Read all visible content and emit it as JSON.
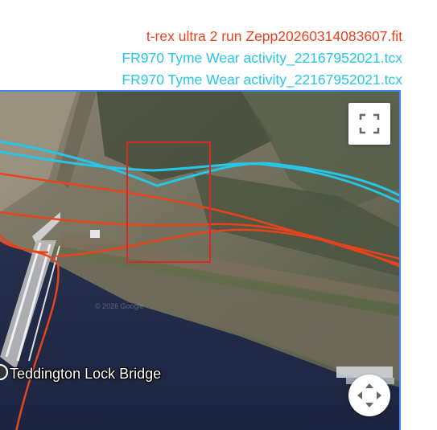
{
  "legend": {
    "tracks": [
      {
        "label": "t-rex ultra 2 run Zepp20260314083607.fit",
        "color": "#e8431b"
      },
      {
        "label": "FR970 Tyme Wear activity_22167952021.tcx",
        "color": "#27c5e6"
      },
      {
        "label": "FR970 Tyme Wear activity_22167952021.tcx",
        "color": "#27c5e6"
      }
    ]
  },
  "map": {
    "place_label": "Teddington Lock Bridge",
    "watermark": "© 2026 Google",
    "controls": {
      "fullscreen_icon": "fullscreen-icon",
      "pan_icon": "pan-arrows-icon"
    },
    "selection_box_color": "#d42a2a",
    "map_type": "satellite"
  }
}
